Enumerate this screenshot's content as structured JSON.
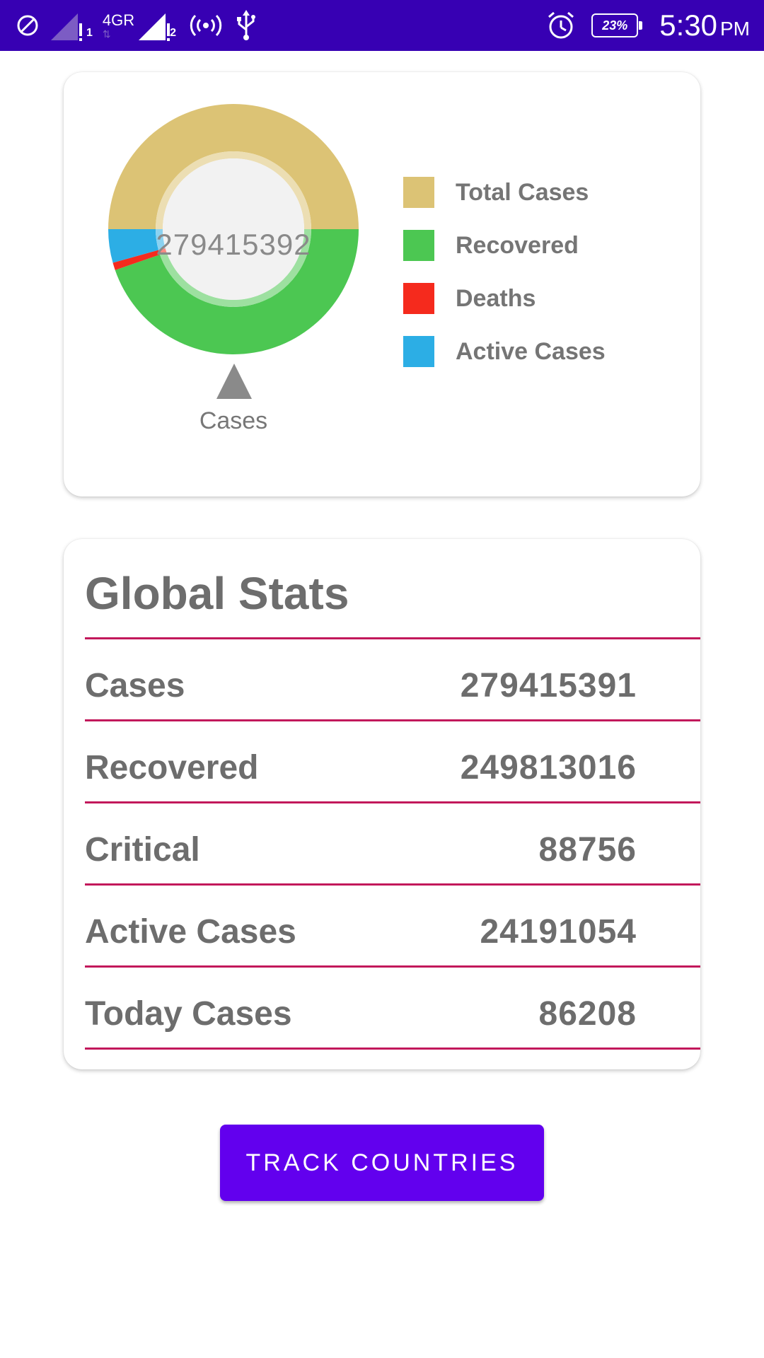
{
  "status_bar": {
    "network": "4GR",
    "sim1": "1",
    "sim2": "2",
    "battery": "23%",
    "time": "5:30",
    "ampm": "PM",
    "icons": [
      "do-not-disturb-icon",
      "signal-icon",
      "hotspot-icon",
      "usb-icon",
      "alarm-icon",
      "battery-icon"
    ]
  },
  "chart_card": {
    "center_text": "279415392",
    "description": "Cases"
  },
  "chart_data": {
    "type": "pie",
    "hole": true,
    "center_text": "279415392",
    "description": "Cases",
    "categories": [
      "Total Cases",
      "Recovered",
      "Deaths",
      "Active Cases"
    ],
    "values": [
      279415391,
      249813016,
      5411322,
      24191054
    ],
    "colors": [
      "#dcc375",
      "#4cc752",
      "#f52a1d",
      "#2caee5"
    ],
    "legend_position": "right"
  },
  "legend": [
    {
      "label": "Total Cases",
      "color": "#dcc375"
    },
    {
      "label": "Recovered",
      "color": "#4cc752"
    },
    {
      "label": "Deaths",
      "color": "#f52a1d"
    },
    {
      "label": "Active Cases",
      "color": "#2caee5"
    }
  ],
  "stats": {
    "title": "Global Stats",
    "rows": [
      {
        "label": "Cases",
        "value": "279415391"
      },
      {
        "label": "Recovered",
        "value": "249813016"
      },
      {
        "label": "Critical",
        "value": "88756"
      },
      {
        "label": "Active Cases",
        "value": "24191054"
      },
      {
        "label": "Today Cases",
        "value": "86208"
      }
    ]
  },
  "button": {
    "label": "TRACK COUNTRIES",
    "color": "#6200ee"
  },
  "colors": {
    "status_bar": "#3700b3",
    "divider": "#c2185b",
    "text": "#6d6d6d"
  }
}
